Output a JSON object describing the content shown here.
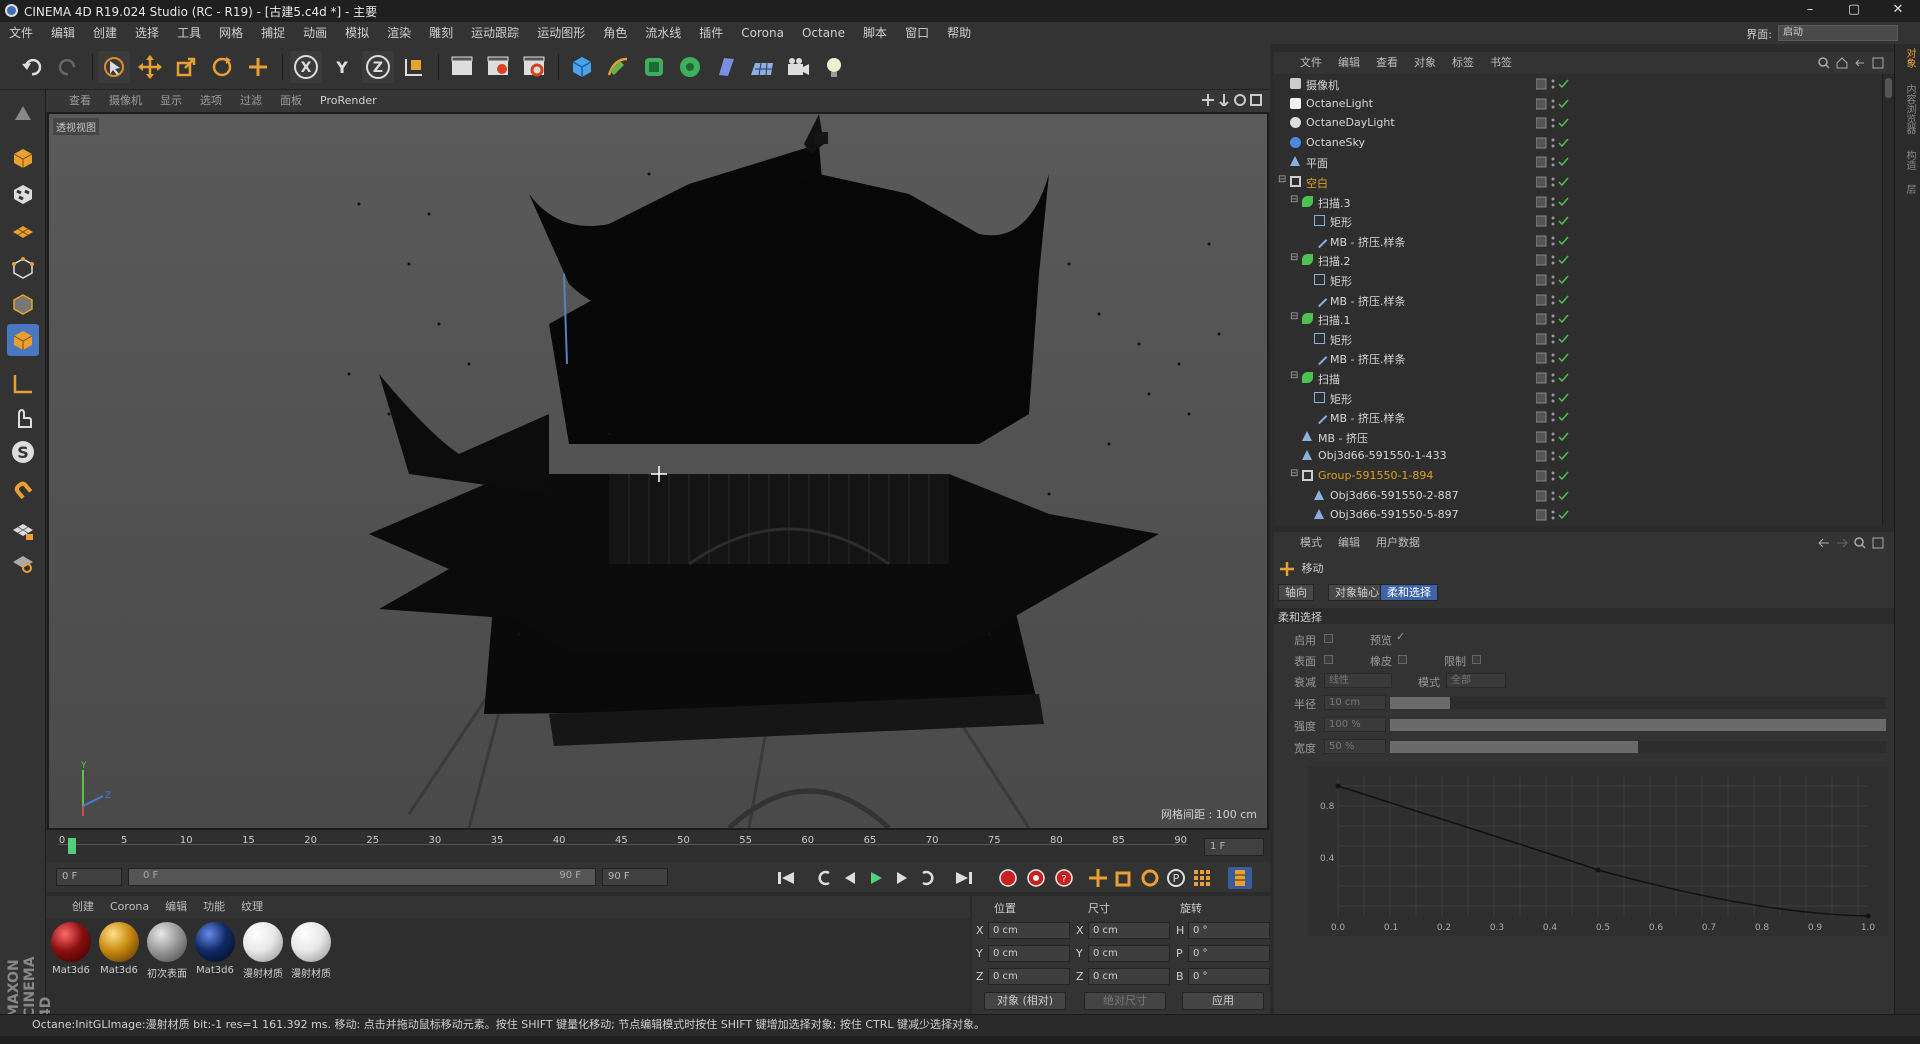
{
  "window": {
    "title": "CINEMA 4D R19.024 Studio (RC - R19) - [古建5.c4d *] - 主要",
    "min": "–",
    "max": "▢",
    "close": "✕"
  },
  "menubar": {
    "items": [
      "文件",
      "编辑",
      "创建",
      "选择",
      "工具",
      "网格",
      "捕捉",
      "动画",
      "模拟",
      "渲染",
      "雕刻",
      "运动跟踪",
      "运动图形",
      "角色",
      "流水线",
      "插件",
      "Corona",
      "Octane",
      "脚本",
      "窗口",
      "帮助"
    ],
    "layout_label": "界面:",
    "layout_value": "启动"
  },
  "toolbar": {
    "axis_x": "X",
    "axis_y": "Y",
    "axis_z": "Z"
  },
  "viewport": {
    "menu": [
      "查看",
      "摄像机",
      "显示",
      "选项",
      "过滤",
      "面板",
      "ProRender"
    ],
    "view_name": "透视视图",
    "grid_spacing": "网格间距 : 100 cm",
    "axis_y": "Y",
    "axis_z": "Z",
    "axis_x": "X"
  },
  "timeline": {
    "ticks": [
      "0",
      "5",
      "10",
      "15",
      "20",
      "25",
      "30",
      "35",
      "40",
      "45",
      "50",
      "55",
      "60",
      "65",
      "70",
      "75",
      "80",
      "85",
      "90"
    ],
    "current_frame": "1 F",
    "start_field": "0 F",
    "range_start": "0 F",
    "range_end": "90 F",
    "end_field": "90 F"
  },
  "materials": {
    "menu": [
      "创建",
      "Corona",
      "编辑",
      "功能",
      "纹理"
    ],
    "items": [
      {
        "label": "Mat3d6",
        "color": "#8a0f0f"
      },
      {
        "label": "Mat3d6",
        "color": "#c88a10"
      },
      {
        "label": "初次表面",
        "color": "#9a9a9a"
      },
      {
        "label": "Mat3d6",
        "color": "#102a66"
      },
      {
        "label": "漫射材质",
        "color": "#e8e8e8"
      },
      {
        "label": "漫射材质",
        "color": "#e8e8e8"
      }
    ]
  },
  "coordinates": {
    "headers": {
      "position": "位置",
      "size": "尺寸",
      "rotation": "旋转"
    },
    "rows": [
      {
        "axis": "X",
        "pos": "0 cm",
        "size_axis": "X",
        "size": "0 cm",
        "rot_axis": "H",
        "rot": "0 °"
      },
      {
        "axis": "Y",
        "pos": "0 cm",
        "size_axis": "Y",
        "size": "0 cm",
        "rot_axis": "P",
        "rot": "0 °"
      },
      {
        "axis": "Z",
        "pos": "0 cm",
        "size_axis": "Z",
        "size": "0 cm",
        "rot_axis": "B",
        "rot": "0 °"
      }
    ],
    "mode_object": "对象 (相对)",
    "mode_size": "绝对尺寸",
    "apply": "应用"
  },
  "status": {
    "text": "Octane:InitGLImage:漫射材质 bit:-1 res=1  161.392 ms.     移动: 点击并拖动鼠标移动元素。按住 SHIFT 键量化移动; 节点编辑模式时按住 SHIFT 键增加选择对象; 按住 CTRL 键减少选择对象。"
  },
  "object_manager": {
    "menu": [
      "文件",
      "编辑",
      "查看",
      "对象",
      "标签",
      "书签"
    ],
    "objects": [
      {
        "name": "摄像机",
        "indent": 0,
        "color": "#d6d6d6",
        "icon": "camera-icon"
      },
      {
        "name": "OctaneLight",
        "indent": 0,
        "color": "#d6d6d6",
        "icon": "light-icon"
      },
      {
        "name": "OctaneDayLight",
        "indent": 0,
        "color": "#d6d6d6",
        "icon": "daylight-icon"
      },
      {
        "name": "OctaneSky",
        "indent": 0,
        "color": "#d6d6d6",
        "icon": "sky-icon"
      },
      {
        "name": "平面",
        "indent": 0,
        "color": "#d6d6d6",
        "icon": "plane-icon"
      },
      {
        "name": "空白",
        "indent": 0,
        "color": "#e0a020",
        "icon": "null-icon"
      },
      {
        "name": "扫描.3",
        "indent": 1,
        "color": "#d6d6d6",
        "icon": "sweep-icon"
      },
      {
        "name": "矩形",
        "indent": 2,
        "color": "#d6d6d6",
        "icon": "rectangle-icon"
      },
      {
        "name": "MB - 挤压.样条",
        "indent": 2,
        "color": "#d6d6d6",
        "icon": "spline-icon"
      },
      {
        "name": "扫描.2",
        "indent": 1,
        "color": "#d6d6d6",
        "icon": "sweep-icon"
      },
      {
        "name": "矩形",
        "indent": 2,
        "color": "#d6d6d6",
        "icon": "rectangle-icon"
      },
      {
        "name": "MB - 挤压.样条",
        "indent": 2,
        "color": "#d6d6d6",
        "icon": "spline-icon"
      },
      {
        "name": "扫描.1",
        "indent": 1,
        "color": "#d6d6d6",
        "icon": "sweep-icon"
      },
      {
        "name": "矩形",
        "indent": 2,
        "color": "#d6d6d6",
        "icon": "rectangle-icon"
      },
      {
        "name": "MB - 挤压.样条",
        "indent": 2,
        "color": "#d6d6d6",
        "icon": "spline-icon"
      },
      {
        "name": "扫描",
        "indent": 1,
        "color": "#d6d6d6",
        "icon": "sweep-icon"
      },
      {
        "name": "矩形",
        "indent": 2,
        "color": "#d6d6d6",
        "icon": "rectangle-icon"
      },
      {
        "name": "MB - 挤压.样条",
        "indent": 2,
        "color": "#d6d6d6",
        "icon": "spline-icon"
      },
      {
        "name": "MB - 挤压",
        "indent": 1,
        "color": "#d6d6d6",
        "icon": "polygon-icon"
      },
      {
        "name": "Obj3d66-591550-1-433",
        "indent": 1,
        "color": "#d6d6d6",
        "icon": "polygon-icon"
      },
      {
        "name": "Group-591550-1-894",
        "indent": 1,
        "color": "#e0a020",
        "icon": "null-icon"
      },
      {
        "name": "Obj3d66-591550-2-887",
        "indent": 2,
        "color": "#d6d6d6",
        "icon": "polygon-icon"
      },
      {
        "name": "Obj3d66-591550-5-897",
        "indent": 2,
        "color": "#d6d6d6",
        "icon": "polygon-icon"
      }
    ]
  },
  "attribute_manager": {
    "menu": [
      "模式",
      "编辑",
      "用户数据"
    ],
    "tool_title": "移动",
    "tabs": [
      "轴向",
      "对象轴心",
      "柔和选择"
    ],
    "section": "柔和选择",
    "fields": {
      "enable": "启用",
      "preview": "预览",
      "surface": "表面",
      "rubber": "橡皮",
      "restrict": "限制",
      "falloff": "衰减",
      "falloff_value": "线性",
      "mode": "模式",
      "mode_value": "全部",
      "radius": "半径",
      "radius_value": "10 cm",
      "strength": "强度",
      "strength_value": "100 %",
      "width": "宽度",
      "width_value": "50 %"
    },
    "graph": {
      "y_ticks": [
        "0.8",
        "0.4"
      ],
      "x_ticks": [
        "0.0",
        "0.1",
        "0.2",
        "0.3",
        "0.4",
        "0.5",
        "0.6",
        "0.7",
        "0.8",
        "0.9",
        "1.0"
      ]
    },
    "levels": {
      "radius": 0.12,
      "strength": 1.0,
      "width": 0.5
    }
  },
  "right_tabs": [
    "对象",
    "内容浏览器",
    "构造",
    "层"
  ]
}
